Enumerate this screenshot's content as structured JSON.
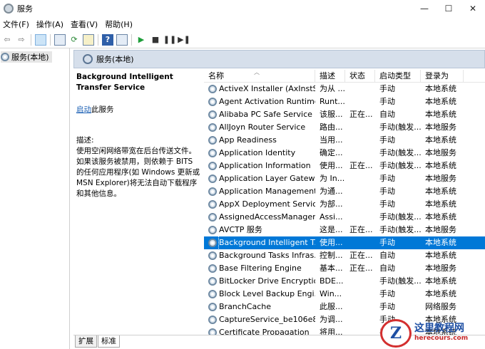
{
  "window": {
    "title": "服务",
    "minimize": "—",
    "maximize": "☐",
    "close": "✕"
  },
  "menu": [
    "文件(F)",
    "操作(A)",
    "查看(V)",
    "帮助(H)"
  ],
  "toolbar_icons": [
    "back-icon",
    "forward-icon",
    "console-tree-icon",
    "properties-icon",
    "refresh-icon",
    "export-icon",
    "help-icon",
    "view-icon",
    "play-icon",
    "stop-icon",
    "pause-icon",
    "restart-icon"
  ],
  "tree": {
    "label": "服务(本地)"
  },
  "pane_header": "服务(本地)",
  "description_panel": {
    "service_name": "Background Intelligent Transfer Service",
    "start_link": "启动",
    "start_suffix": "此服务",
    "desc_title": "描述:",
    "desc_text": "使用空闲网络带宽在后台传送文件。如果该服务被禁用，则依赖于 BITS 的任何应用程序(如 Windows 更新或 MSN Explorer)将无法自动下载程序和其他信息。"
  },
  "columns": [
    "名称",
    "描述",
    "状态",
    "启动类型",
    "登录为"
  ],
  "services": [
    {
      "name": "ActiveX Installer (AxInstSV)",
      "desc": "为从 ...",
      "status": "",
      "startup": "手动",
      "logon": "本地系统"
    },
    {
      "name": "Agent Activation Runtime...",
      "desc": "Runt...",
      "status": "",
      "startup": "手动",
      "logon": "本地系统"
    },
    {
      "name": "Alibaba PC Safe Service",
      "desc": "该服...",
      "status": "正在...",
      "startup": "自动",
      "logon": "本地系统"
    },
    {
      "name": "AllJoyn Router Service",
      "desc": "路由...",
      "status": "",
      "startup": "手动(触发...",
      "logon": "本地服务"
    },
    {
      "name": "App Readiness",
      "desc": "当用...",
      "status": "",
      "startup": "手动",
      "logon": "本地系统"
    },
    {
      "name": "Application Identity",
      "desc": "确定...",
      "status": "",
      "startup": "手动(触发...",
      "logon": "本地服务"
    },
    {
      "name": "Application Information",
      "desc": "使用...",
      "status": "正在...",
      "startup": "手动(触发...",
      "logon": "本地系统"
    },
    {
      "name": "Application Layer Gatewa...",
      "desc": "为 In...",
      "status": "",
      "startup": "手动",
      "logon": "本地服务"
    },
    {
      "name": "Application Management",
      "desc": "为通...",
      "status": "",
      "startup": "手动",
      "logon": "本地系统"
    },
    {
      "name": "AppX Deployment Servic...",
      "desc": "为部...",
      "status": "",
      "startup": "手动",
      "logon": "本地系统"
    },
    {
      "name": "AssignedAccessManager...",
      "desc": "Assi...",
      "status": "",
      "startup": "手动(触发...",
      "logon": "本地系统"
    },
    {
      "name": "AVCTP 服务",
      "desc": "这是...",
      "status": "正在...",
      "startup": "手动(触发...",
      "logon": "本地服务"
    },
    {
      "name": "Background Intelligent T...",
      "desc": "使用...",
      "status": "",
      "startup": "手动",
      "logon": "本地系统",
      "selected": true
    },
    {
      "name": "Background Tasks Infras...",
      "desc": "控制...",
      "status": "正在...",
      "startup": "自动",
      "logon": "本地系统"
    },
    {
      "name": "Base Filtering Engine",
      "desc": "基本...",
      "status": "正在...",
      "startup": "自动",
      "logon": "本地服务"
    },
    {
      "name": "BitLocker Drive Encryptio...",
      "desc": "BDE...",
      "status": "",
      "startup": "手动(触发...",
      "logon": "本地系统"
    },
    {
      "name": "Block Level Backup Engi...",
      "desc": "Win...",
      "status": "",
      "startup": "手动",
      "logon": "本地系统"
    },
    {
      "name": "BranchCache",
      "desc": "此服...",
      "status": "",
      "startup": "手动",
      "logon": "网络服务"
    },
    {
      "name": "CaptureService_be106e8",
      "desc": "为调...",
      "status": "",
      "startup": "手动",
      "logon": "本地系统"
    },
    {
      "name": "Certificate Propagation",
      "desc": "将用...",
      "status": "",
      "startup": "手动",
      "logon": "本地系统"
    }
  ],
  "tabs": [
    "扩展",
    "标准"
  ],
  "watermark": {
    "logo": "Z",
    "text": "这里教程网",
    "url": "herecours.com"
  }
}
